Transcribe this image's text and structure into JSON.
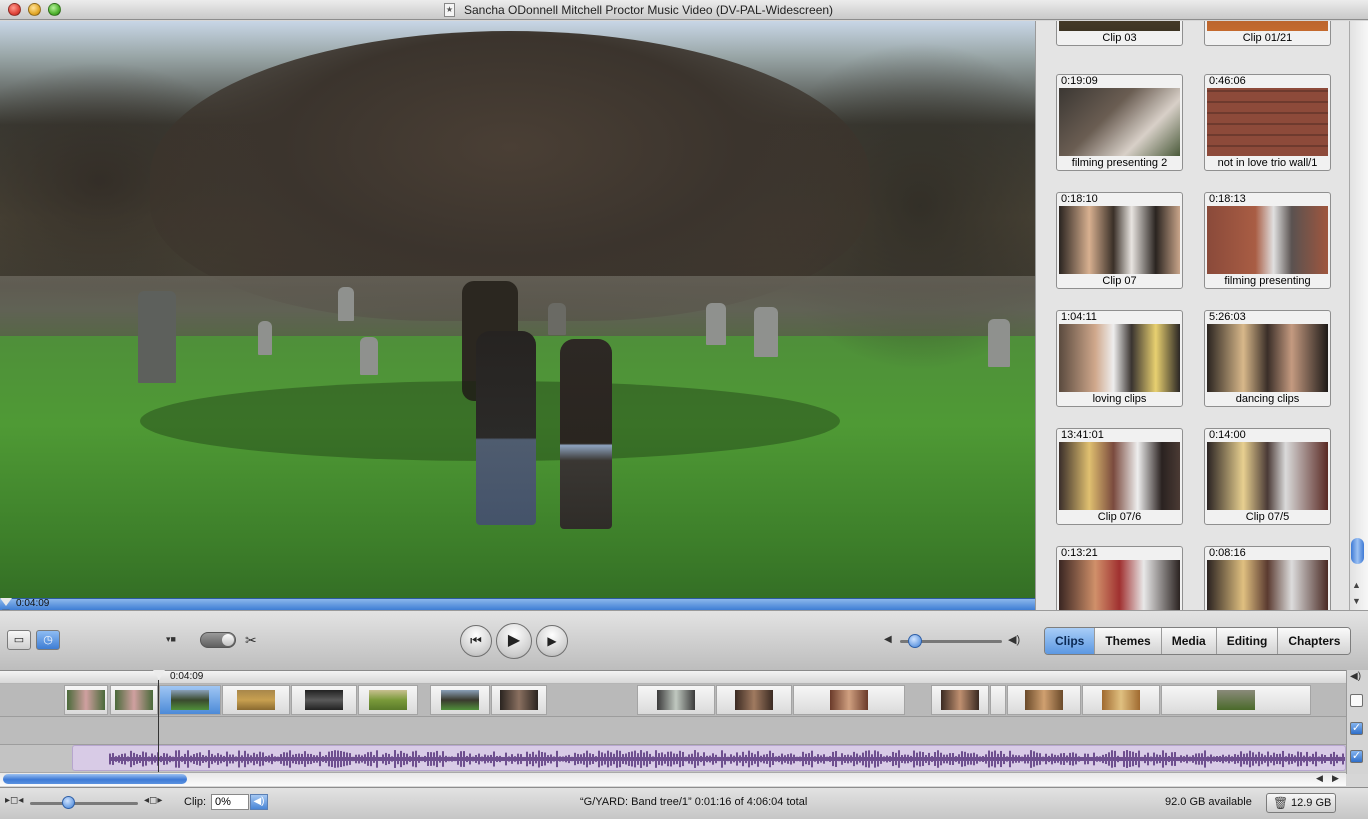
{
  "window": {
    "title": "Sancha ODonnell Mitchell Proctor Music Video (DV-PAL-Widescreen)"
  },
  "viewer": {
    "current_time": "0:04:09"
  },
  "clips_pane": {
    "partial_top": [
      {
        "name": "Clip 03"
      },
      {
        "name": "Clip 01/21"
      }
    ],
    "clips": [
      {
        "duration": "0:19:09",
        "name": "filming presenting 2"
      },
      {
        "duration": "0:46:06",
        "name": "not in love trio wall/1"
      },
      {
        "duration": "0:18:10",
        "name": "Clip 07"
      },
      {
        "duration": "0:18:13",
        "name": "filming presenting"
      },
      {
        "duration": "1:04:11",
        "name": "loving clips"
      },
      {
        "duration": "5:26:03",
        "name": "dancing clips"
      },
      {
        "duration": "13:41:01",
        "name": "Clip 07/6"
      },
      {
        "duration": "0:14:00",
        "name": "Clip 07/5"
      },
      {
        "duration": "0:13:21",
        "name": ""
      },
      {
        "duration": "0:08:16",
        "name": ""
      }
    ]
  },
  "controls": {
    "volume_level": 0.15,
    "tabs": [
      "Clips",
      "Themes",
      "Media",
      "Editing",
      "Chapters"
    ],
    "active_tab": "Clips"
  },
  "timeline": {
    "playhead_time": "0:04:09"
  },
  "status": {
    "clip_label": "Clip:",
    "clip_volume": "0%",
    "info": "“G/YARD: Band tree/1”  0:01:16 of 4:06:04 total",
    "available": "92.0 GB available",
    "trash_size": "12.9 GB"
  },
  "icons": {
    "speaker": "◀",
    "scissors": "✂",
    "rewind": "⏮",
    "play": "▶",
    "check": "✓"
  }
}
